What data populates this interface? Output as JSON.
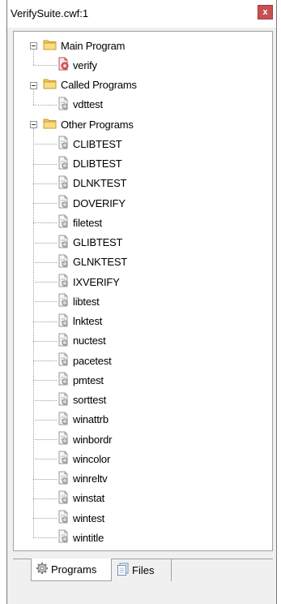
{
  "window": {
    "title": "VerifySuite.cwf:1",
    "close_glyph": "x",
    "accent": "#c75050"
  },
  "tree": {
    "groups": [
      {
        "label": "Main Program",
        "items": [
          "verify"
        ],
        "first_item_icon": "red-gear-file"
      },
      {
        "label": "Called Programs",
        "items": [
          "vdttest"
        ]
      },
      {
        "label": "Other Programs",
        "items": [
          "CLIBTEST",
          "DLIBTEST",
          "DLNKTEST",
          "DOVERIFY",
          "filetest",
          "GLIBTEST",
          "GLNKTEST",
          "IXVERIFY",
          "libtest",
          "lnktest",
          "nuctest",
          "pacetest",
          "pmtest",
          "sorttest",
          "winattrb",
          "winbordr",
          "wincolor",
          "winreltv",
          "winstat",
          "wintest",
          "wintitle"
        ]
      }
    ]
  },
  "tabs": {
    "programs_label": "Programs",
    "files_label": "Files",
    "programs_icon": "gear-icon",
    "files_icon": "pages-icon"
  }
}
